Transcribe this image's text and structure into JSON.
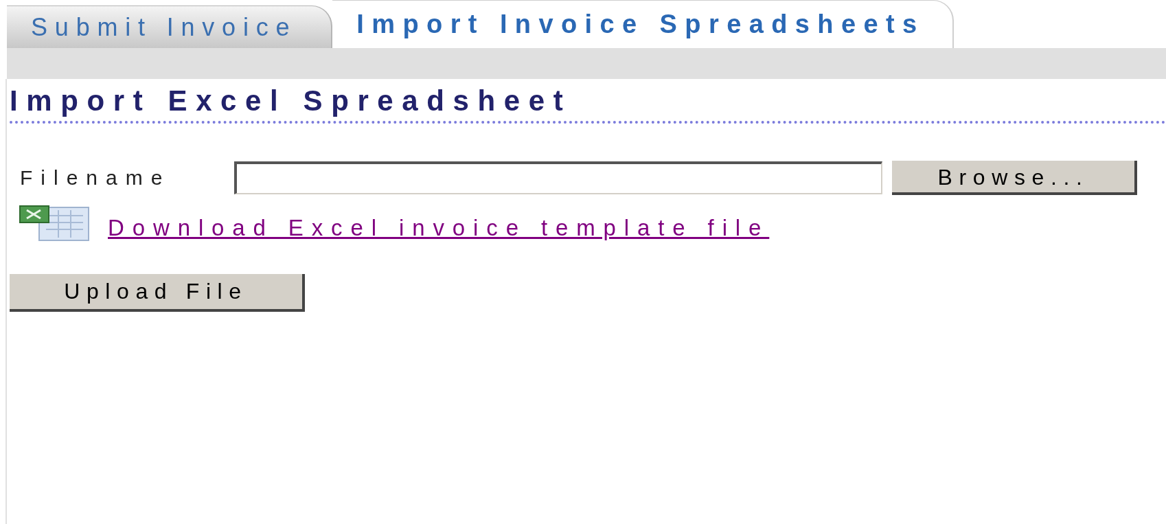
{
  "tabs": [
    {
      "label": "Submit Invoice",
      "selected": false
    },
    {
      "label": "Import Invoice Spreadsheets",
      "selected": true
    }
  ],
  "heading": "Import Excel Spreadsheet",
  "form": {
    "filename_label": "Filename",
    "browse_button": "Browse...",
    "download_link": "Download Excel invoice template file",
    "upload_button": "Upload File"
  }
}
